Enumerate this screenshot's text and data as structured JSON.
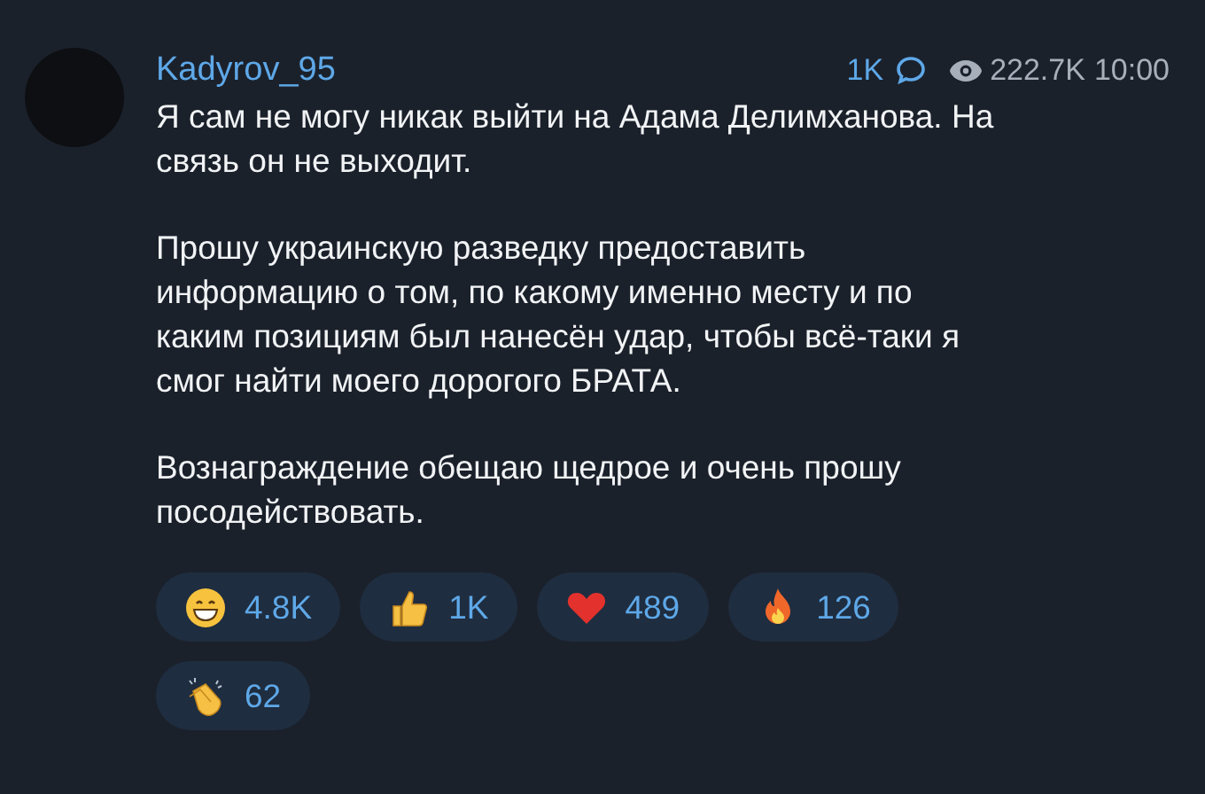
{
  "post": {
    "author": "Kadyrov_95",
    "comments": "1K",
    "views": "222.7K",
    "time": "10:00",
    "paragraphs": [
      "Я сам не могу никак выйти на Адама Делимханова. На связь он не выходит.",
      "Прошу украинскую разведку предоставить информацию о том, по какому именно месту и по каким позициям был нанесён удар, чтобы всё-таки я смог найти моего дорогого БРАТА.",
      "Вознаграждение обещаю щедрое и очень прошу посодействовать."
    ],
    "reactions": [
      {
        "kind": "grin",
        "count": "4.8K"
      },
      {
        "kind": "thumbs",
        "count": "1K"
      },
      {
        "kind": "heart",
        "count": "489"
      },
      {
        "kind": "fire",
        "count": "126"
      },
      {
        "kind": "clap",
        "count": "62"
      }
    ]
  }
}
